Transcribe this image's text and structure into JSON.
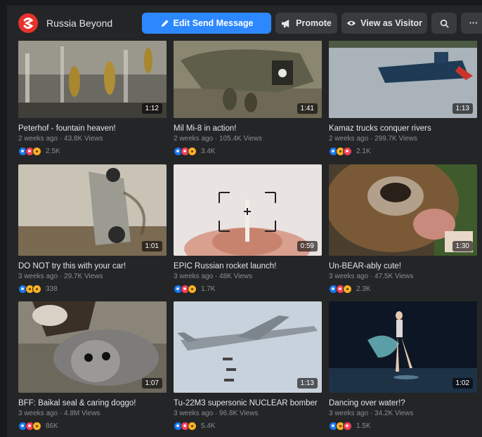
{
  "header": {
    "page_name": "Russia Beyond",
    "edit_send_message": "Edit Send Message",
    "promote": "Promote",
    "view_as_visitor": "View as Visitor",
    "more": "···",
    "brand_color": "#e8322c",
    "accent_color": "#2d88ff"
  },
  "videos": [
    {
      "title": "Peterhof - fountain heaven!",
      "meta": "2 weeks ago · 43.8K Views",
      "duration": "1:12",
      "reactions": [
        "like",
        "love",
        "wow"
      ],
      "reaction_count": "2.5K"
    },
    {
      "title": "Mil Mi-8 in action!",
      "meta": "2 weeks ago · 105.4K Views",
      "duration": "1:41",
      "reactions": [
        "like",
        "love",
        "wow"
      ],
      "reaction_count": "3.4K"
    },
    {
      "title": "Kamaz trucks conquer rivers",
      "meta": "2 weeks ago · 299.7K Views",
      "duration": "1:13",
      "reactions": [
        "like",
        "wow",
        "love"
      ],
      "reaction_count": "2.1K"
    },
    {
      "title": "DO NOT try this with your car!",
      "meta": "3 weeks ago · 29.7K Views",
      "duration": "1:01",
      "reactions": [
        "like",
        "haha",
        "wow"
      ],
      "reaction_count": "338"
    },
    {
      "title": "EPIC Russian rocket launch!",
      "meta": "3 weeks ago · 48K Views",
      "duration": "0:59",
      "reactions": [
        "like",
        "love",
        "wow"
      ],
      "reaction_count": "1.7K"
    },
    {
      "title": "Un-BEAR-ably cute!",
      "meta": "3 weeks ago · 47.5K Views",
      "duration": "1:30",
      "reactions": [
        "like",
        "love",
        "haha"
      ],
      "reaction_count": "2.3K"
    },
    {
      "title": "BFF: Baikal seal & caring doggo!",
      "meta": "3 weeks ago · 4.8M Views",
      "duration": "1:07",
      "reactions": [
        "like",
        "love",
        "haha"
      ],
      "reaction_count": "86K"
    },
    {
      "title": "Tu-22M3 supersonic NUCLEAR bomber",
      "meta": "3 weeks ago · 96.8K Views",
      "duration": "1:13",
      "reactions": [
        "like",
        "love",
        "wow"
      ],
      "reaction_count": "5.4K"
    },
    {
      "title": "Dancing over water!?",
      "meta": "3 weeks ago · 34.2K Views",
      "duration": "1:02",
      "reactions": [
        "like",
        "wow",
        "love"
      ],
      "reaction_count": "1.5K"
    }
  ]
}
